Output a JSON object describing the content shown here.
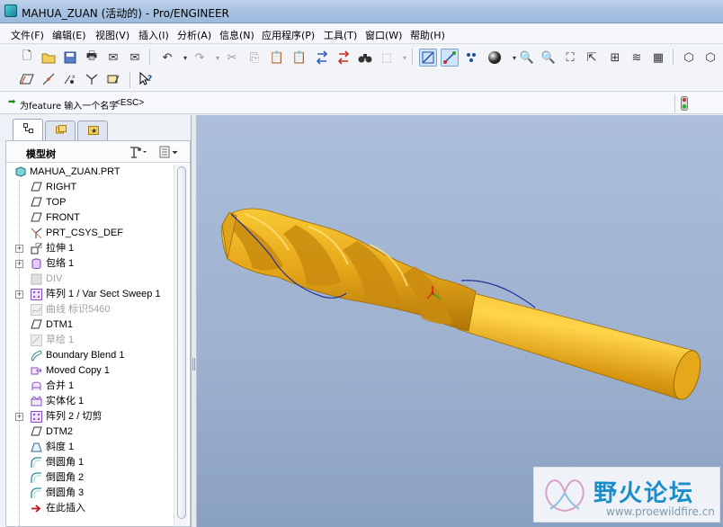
{
  "window": {
    "title": "MAHUA_ZUAN (活动的) - Pro/ENGINEER"
  },
  "menu": [
    "文件(F)",
    "编辑(E)",
    "视图(V)",
    "插入(I)",
    "分析(A)",
    "信息(N)",
    "应用程序(P)",
    "工具(T)",
    "窗口(W)",
    "帮助(H)"
  ],
  "message": {
    "prompt": "为feature 输入一个名字",
    "esc": "<ESC>"
  },
  "panel": {
    "title": "模型树"
  },
  "tree": {
    "root": "MAHUA_ZUAN.PRT",
    "items": [
      {
        "label": "RIGHT",
        "icon": "datum-plane-icon"
      },
      {
        "label": "TOP",
        "icon": "datum-plane-icon"
      },
      {
        "label": "FRONT",
        "icon": "datum-plane-icon"
      },
      {
        "label": "PRT_CSYS_DEF",
        "icon": "csys-icon"
      },
      {
        "label": "拉伸 1",
        "icon": "extrude-icon"
      },
      {
        "label": "包络 1",
        "icon": "wrap-icon"
      },
      {
        "label": "DIV",
        "icon": "suppressed-feature-icon"
      },
      {
        "label": "阵列 1 / Var Sect Sweep 1",
        "icon": "pattern-icon"
      },
      {
        "label": "曲线 标识5460",
        "icon": "curve-icon"
      },
      {
        "label": "DTM1",
        "icon": "datum-plane-icon"
      },
      {
        "label": "草绘 1",
        "icon": "sketch-icon"
      },
      {
        "label": "Boundary Blend 1",
        "icon": "boundary-blend-icon"
      },
      {
        "label": "Moved Copy 1",
        "icon": "moved-copy-icon"
      },
      {
        "label": "合并 1",
        "icon": "merge-icon"
      },
      {
        "label": "实体化 1",
        "icon": "solidify-icon"
      },
      {
        "label": "阵列 2 / 切剪",
        "icon": "pattern-icon"
      },
      {
        "label": "DTM2",
        "icon": "datum-plane-icon"
      },
      {
        "label": "斜度 1",
        "icon": "draft-icon"
      },
      {
        "label": "倒圆角 1",
        "icon": "round-icon"
      },
      {
        "label": "倒圆角 2",
        "icon": "round-icon"
      },
      {
        "label": "倒圆角 3",
        "icon": "round-icon"
      },
      {
        "label": "在此插入",
        "icon": "insert-here-icon"
      }
    ]
  },
  "watermark": {
    "text": "野火论坛",
    "url": "www.proewildfire.cn"
  }
}
